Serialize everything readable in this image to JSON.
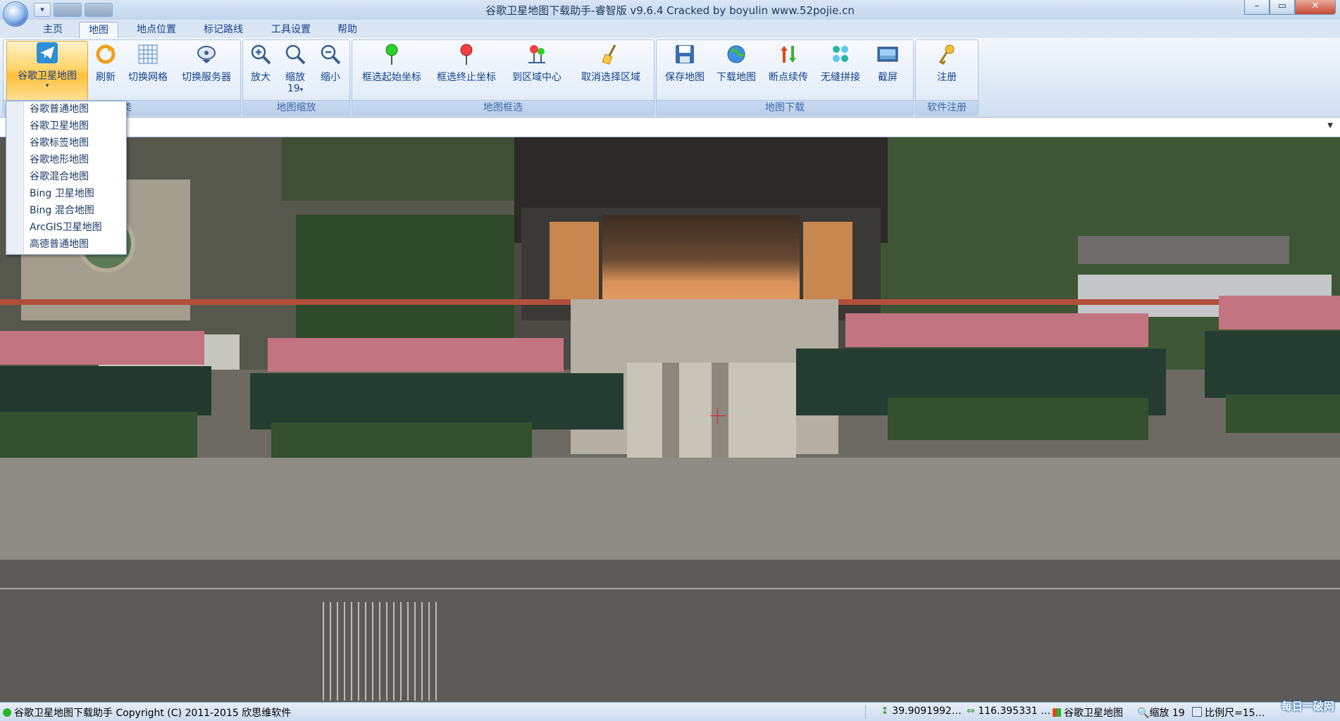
{
  "window": {
    "title": "谷歌卫星地图下载助手-睿智版 v9.6.4 Cracked by boyulin www.52pojie.cn",
    "controls": {
      "minimize": "–",
      "maximize": "▭",
      "close": "✕"
    }
  },
  "tabs": [
    {
      "label": "主页"
    },
    {
      "label": "地图",
      "active": true
    },
    {
      "label": "地点位置"
    },
    {
      "label": "标记路线"
    },
    {
      "label": "工具设置"
    },
    {
      "label": "帮助"
    }
  ],
  "ribbon": {
    "groups": [
      {
        "label": "分类",
        "buttons": [
          "谷歌卫星地图",
          "刷新",
          "切换网格",
          "切换服务器"
        ]
      },
      {
        "label": "地图缩放",
        "buttons": [
          "放大",
          "缩放",
          "缩小"
        ],
        "zoom_value": "19"
      },
      {
        "label": "地图框选",
        "buttons": [
          "框选起始坐标",
          "框选终止坐标",
          "到区域中心",
          "取消选择区域"
        ]
      },
      {
        "label": "地图下载",
        "buttons": [
          "保存地图",
          "下载地图",
          "断点续传",
          "无缝拼接",
          "截屏"
        ]
      },
      {
        "label": "软件注册",
        "buttons": [
          "注册"
        ]
      }
    ]
  },
  "map_type_menu": {
    "items": [
      "谷歌普通地图",
      "谷歌卫星地图",
      "谷歌标签地图",
      "谷歌地形地图",
      "谷歌混合地图",
      "Bing 卫星地图",
      "Bing 混合地图",
      "ArcGIS卫星地图",
      "高德普通地图"
    ]
  },
  "statusbar": {
    "app_info": "谷歌卫星地图下载助手 Copyright (C) 2011-2015 欣思维软件",
    "latitude": "39.9091992…",
    "longitude": "116.395331 …",
    "map_type": "谷歌卫星地图",
    "zoom": "缩放 19",
    "scale": "比例尺=15…",
    "watermark": "每日一破网"
  },
  "colors": {
    "ribbon_bg": "#dbe7f5",
    "accent_text": "#15428b",
    "hot_button": "#ffd56a"
  },
  "icons": [
    "telegram-plane-icon",
    "refresh-icon",
    "grid-icon",
    "satellite-dish-icon",
    "zoom-in-icon",
    "zoom-icon",
    "zoom-out-icon",
    "green-pin-icon",
    "red-pin-icon",
    "area-center-icon",
    "broom-icon",
    "floppy-icon",
    "globe-download-icon",
    "resume-icon",
    "puzzle-icon",
    "screenshot-icon",
    "key-icon"
  ]
}
